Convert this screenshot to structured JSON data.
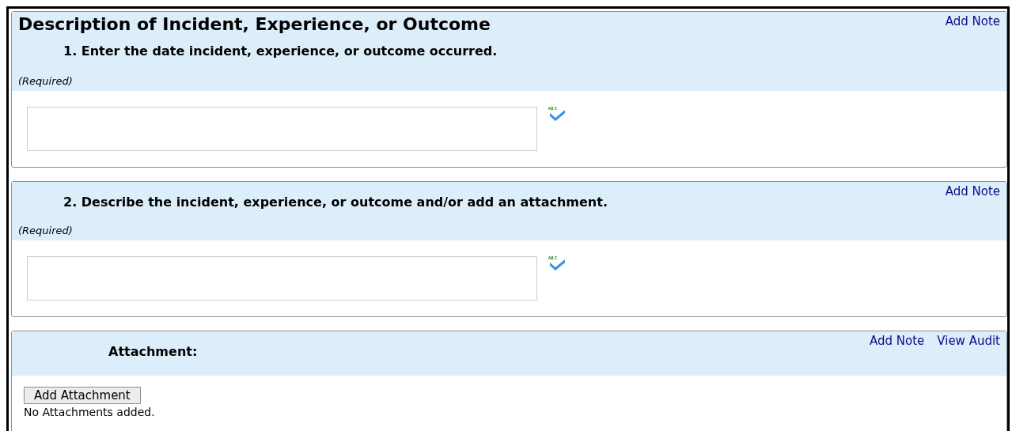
{
  "page_title": "Description of Incident, Experience, or Outcome",
  "sections": [
    {
      "kind": "question",
      "question": "1. Enter the date incident, experience, or outcome occurred.",
      "required": "(Required)",
      "links": [
        "Add Note"
      ]
    },
    {
      "kind": "question",
      "question": "2. Describe the incident, experience, or outcome and/or add an attachment.",
      "required": "(Required)",
      "links": [
        "Add Note"
      ]
    },
    {
      "kind": "attachment",
      "label": "Attachment:",
      "links": [
        "Add Note",
        "View Audit"
      ],
      "button": "Add Attachment",
      "status": "No Attachments added."
    }
  ]
}
